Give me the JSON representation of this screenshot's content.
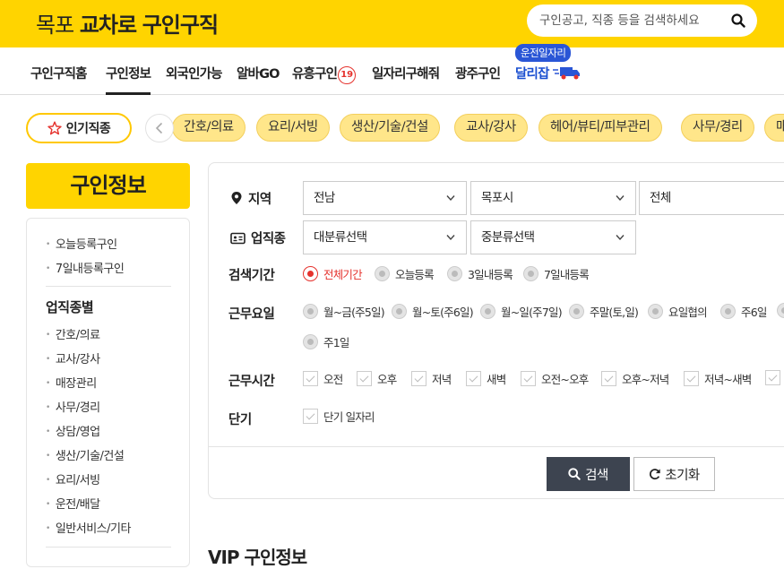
{
  "header": {
    "logo_prefix": "목포",
    "logo_bold": "교차로",
    "logo_suffix": "구인구직",
    "search_placeholder": "구인공고, 직종 등을 검색하세요"
  },
  "nav": {
    "items": [
      "구인구직홈",
      "구인정보",
      "외국인가능",
      "알바GO",
      "유흥구인",
      "일자리구해줘",
      "광주구인",
      "달리잡"
    ],
    "badge": "19",
    "driver_tag": "운전일자리",
    "active": "구인정보"
  },
  "popular": {
    "button_label": "인기직종",
    "chips": [
      "간호/의료",
      "요리/서빙",
      "생산/기술/건설",
      "교사/강사",
      "헤어/뷰티/피부관리",
      "사무/경리",
      "매"
    ]
  },
  "sidebar": {
    "title": "구인정보",
    "links_top": [
      "오늘등록구인",
      "7일내등록구인"
    ],
    "section_heading": "업직종별",
    "categories": [
      "간호/의료",
      "교사/강사",
      "매장관리",
      "사무/경리",
      "상담/영업",
      "생산/기술/건설",
      "요리/서빙",
      "운전/배달",
      "일반서비스/기타"
    ]
  },
  "filters": {
    "region_label": "지역",
    "region_selects": [
      "전남",
      "목포시",
      "전체"
    ],
    "job_label": "업직종",
    "job_selects": [
      "대분류선택",
      "중분류선택"
    ],
    "period_label": "검색기간",
    "period_options": [
      "전체기간",
      "오늘등록",
      "3일내등록",
      "7일내등록"
    ],
    "days_label": "근무요일",
    "days_options": [
      "월~금(주5일)",
      "월~토(주6일)",
      "월~일(주7일)",
      "주말(토,일)",
      "요일협의",
      "주6일",
      "주1일"
    ],
    "hours_label": "근무시간",
    "hours_options": [
      "오전",
      "오후",
      "저녁",
      "새벽",
      "오전~오후",
      "오후~저녁",
      "저녁~새벽"
    ],
    "short_label": "단기",
    "short_option": "단기 일자리"
  },
  "buttons": {
    "search": "검색",
    "reset": "초기화"
  },
  "section_vip": "VIP 구인정보",
  "colors": {
    "brand_yellow": "#ffd400",
    "accent_red": "#e5322d",
    "nav_blue": "#1a4fd0",
    "search_btn": "#3d4450"
  }
}
